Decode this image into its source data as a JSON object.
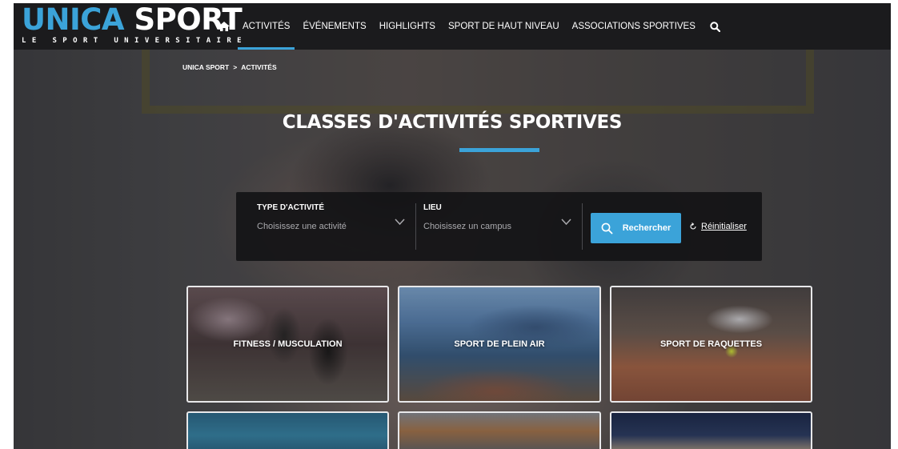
{
  "brand": {
    "name_part1": "UNICA",
    "name_part2": "SPORT",
    "tagline": "LE SPORT UNIVERSITAIRE",
    "accent_color": "#3ba3d9"
  },
  "nav": {
    "items": [
      {
        "label": "Activités",
        "active": true
      },
      {
        "label": "Événements",
        "active": false
      },
      {
        "label": "Highlights",
        "active": false
      },
      {
        "label": "Sport de haut niveau",
        "active": false
      },
      {
        "label": "Associations sportives",
        "active": false
      }
    ],
    "home_icon": "home-icon",
    "search_icon": "search-icon"
  },
  "breadcrumb": {
    "home": "UNICA SPORT",
    "separator": ">",
    "current": "ACTIVITÉS"
  },
  "page_title": "CLASSES D'ACTIVITÉS SPORTIVES",
  "filter": {
    "activity": {
      "label": "TYPE D'ACTIVITÉ",
      "value": "Choisissez une activité"
    },
    "location": {
      "label": "LIEU",
      "value": "Choisissez un campus"
    },
    "search_button": "Rechercher",
    "reset_link": "Réinitialiser"
  },
  "cards": [
    {
      "label": "FITNESS / MUSCULATION"
    },
    {
      "label": "SPORT DE PLEIN AIR"
    },
    {
      "label": "SPORT DE RAQUETTES"
    },
    {
      "label": ""
    },
    {
      "label": ""
    },
    {
      "label": ""
    }
  ]
}
